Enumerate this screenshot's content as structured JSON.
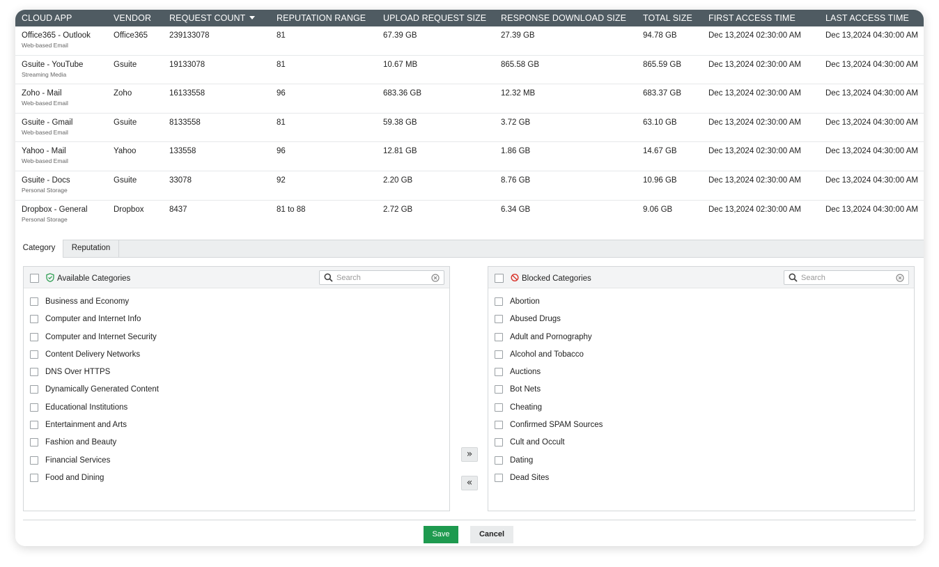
{
  "table": {
    "headers": {
      "cloud_app": "CLOUD APP",
      "vendor": "VENDOR",
      "request_count": "REQUEST COUNT",
      "reputation_range": "REPUTATION RANGE",
      "upload_request_size": "UPLOAD REQUEST SIZE",
      "response_download_size": "RESPONSE DOWNLOAD SIZE",
      "total_size": "TOTAL SIZE",
      "first_access_time": "FIRST ACCESS TIME",
      "last_access_time": "LAST ACCESS TIME"
    },
    "sort_column": "request_count",
    "rows": [
      {
        "app": "Office365 - Outlook",
        "category": "Web-based Email",
        "vendor": "Office365",
        "requests": "239133078",
        "reputation": "81",
        "upload": "67.39 GB",
        "download": "27.39 GB",
        "total": "94.78 GB",
        "first": "Dec 13,2024 02:30:00 AM",
        "last": "Dec 13,2024 04:30:00 AM"
      },
      {
        "app": "Gsuite - YouTube",
        "category": "Streaming Media",
        "vendor": "Gsuite",
        "requests": "19133078",
        "reputation": "81",
        "upload": "10.67 MB",
        "download": "865.58 GB",
        "total": "865.59 GB",
        "first": "Dec 13,2024 02:30:00 AM",
        "last": "Dec 13,2024 04:30:00 AM"
      },
      {
        "app": "Zoho - Mail",
        "category": "Web-based Email",
        "vendor": "Zoho",
        "requests": "16133558",
        "reputation": "96",
        "upload": "683.36 GB",
        "download": "12.32 MB",
        "total": "683.37 GB",
        "first": "Dec 13,2024 02:30:00 AM",
        "last": "Dec 13,2024 04:30:00 AM"
      },
      {
        "app": "Gsuite - Gmail",
        "category": "Web-based Email",
        "vendor": "Gsuite",
        "requests": "8133558",
        "reputation": "81",
        "upload": "59.38 GB",
        "download": "3.72 GB",
        "total": "63.10 GB",
        "first": "Dec 13,2024 02:30:00 AM",
        "last": "Dec 13,2024 04:30:00 AM"
      },
      {
        "app": "Yahoo - Mail",
        "category": "Web-based Email",
        "vendor": "Yahoo",
        "requests": "133558",
        "reputation": "96",
        "upload": "12.81 GB",
        "download": "1.86 GB",
        "total": "14.67 GB",
        "first": "Dec 13,2024 02:30:00 AM",
        "last": "Dec 13,2024 04:30:00 AM"
      },
      {
        "app": "Gsuite - Docs",
        "category": "Personal Storage",
        "vendor": "Gsuite",
        "requests": "33078",
        "reputation": "92",
        "upload": "2.20 GB",
        "download": "8.76 GB",
        "total": "10.96 GB",
        "first": "Dec 13,2024 02:30:00 AM",
        "last": "Dec 13,2024 04:30:00 AM"
      },
      {
        "app": "Dropbox - General",
        "category": "Personal Storage",
        "vendor": "Dropbox",
        "requests": "8437",
        "reputation": "81 to 88",
        "upload": "2.72 GB",
        "download": "6.34 GB",
        "total": "9.06 GB",
        "first": "Dec 13,2024 02:30:00 AM",
        "last": "Dec 13,2024 04:30:00 AM"
      }
    ]
  },
  "tabs": [
    {
      "label": "Category",
      "active": true
    },
    {
      "label": "Reputation",
      "active": false
    }
  ],
  "available": {
    "title": "Available Categories",
    "icon": "shield-check-icon",
    "search_placeholder": "Search",
    "items": [
      "Business and Economy",
      "Computer and Internet Info",
      "Computer and Internet Security",
      "Content Delivery Networks",
      "DNS Over HTTPS",
      "Dynamically Generated Content",
      "Educational Institutions",
      "Entertainment and Arts",
      "Fashion and Beauty",
      "Financial Services",
      "Food and Dining"
    ]
  },
  "blocked": {
    "title": "Blocked Categories",
    "icon": "blocked-icon",
    "search_placeholder": "Search",
    "items": [
      "Abortion",
      "Abused Drugs",
      "Adult and Pornography",
      "Alcohol and Tobacco",
      "Auctions",
      "Bot Nets",
      "Cheating",
      "Confirmed SPAM Sources",
      "Cult and Occult",
      "Dating",
      "Dead Sites"
    ]
  },
  "move": {
    "right": "»",
    "left": "«"
  },
  "footer": {
    "save": "Save",
    "cancel": "Cancel"
  },
  "colors": {
    "header_bg": "#4f5b62",
    "save_bg": "#1e9a4f",
    "shield_green": "#2e9e52",
    "block_red": "#d9342b"
  }
}
